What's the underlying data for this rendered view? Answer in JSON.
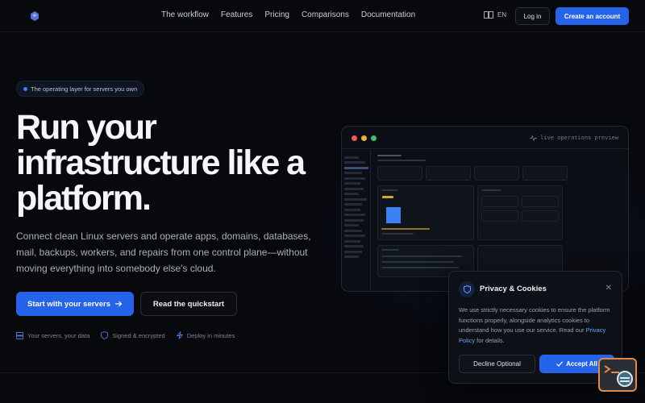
{
  "nav": {
    "links": [
      "The workflow",
      "Features",
      "Pricing",
      "Comparisons",
      "Documentation"
    ],
    "lang": "EN",
    "login": "Log in",
    "create": "Create an account"
  },
  "hero": {
    "badge": "The operating layer for servers you own",
    "title": "Run your infrastructure like a platform.",
    "description": "Connect clean Linux servers and operate apps, domains, databases, mail, backups, workers, and repairs from one control plane—without moving everything into somebody else's cloud.",
    "cta_primary": "Start with your servers",
    "cta_secondary": "Read the quickstart",
    "features": [
      "Your servers, your data",
      "Signed & encrypted",
      "Deploy in minutes"
    ]
  },
  "preview": {
    "label": "live operations preview"
  },
  "cookie": {
    "title": "Privacy & Cookies",
    "text": "We use strictly necessary cookies to ensure the platform functions properly, alongside analytics cookies to understand how you use our service. Read our",
    "link": "Privacy Policy",
    "text_end": "for details.",
    "decline": "Decline Optional",
    "accept": "Accept All"
  },
  "colors": {
    "accent": "#2563eb",
    "link": "#60a5fa",
    "background": "#07090d"
  },
  "icons": {
    "logo": "logo-icon",
    "language": "book-icon",
    "arrow": "arrow-right-icon",
    "server": "server-icon",
    "shield": "shield-icon",
    "bolt": "lightning-icon",
    "activity": "activity-icon",
    "close": "close-icon",
    "check": "check-icon"
  }
}
